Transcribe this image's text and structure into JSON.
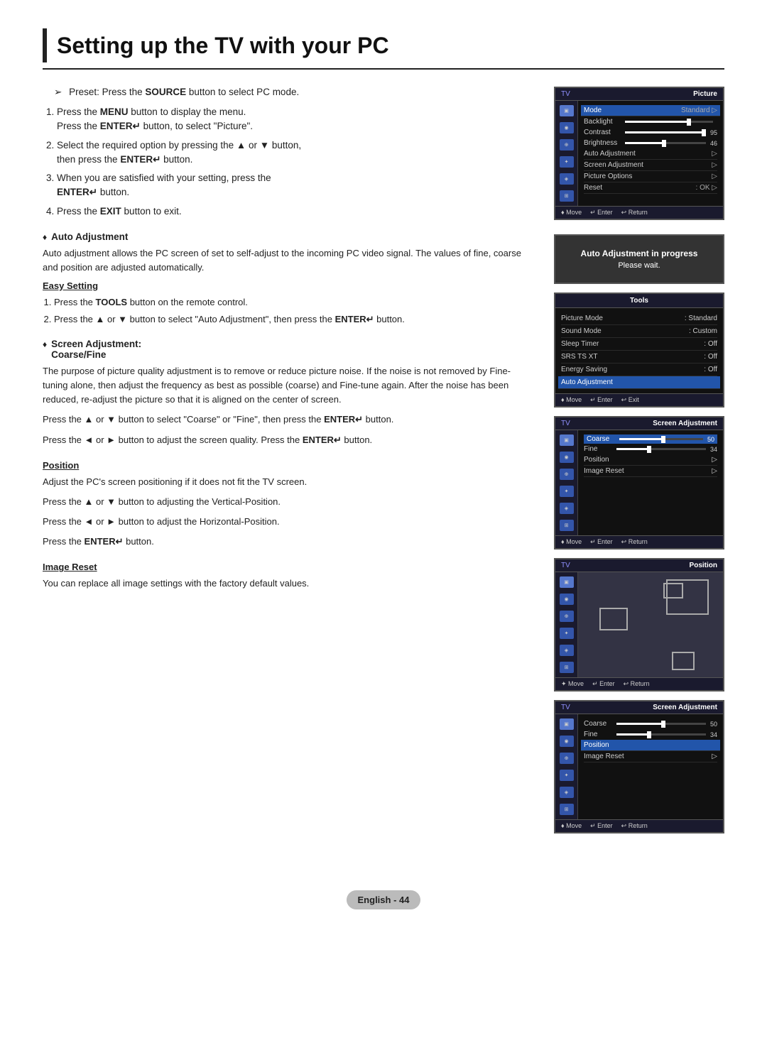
{
  "page": {
    "title": "Setting up the TV with your PC"
  },
  "preset": {
    "text": "Preset: Press the ",
    "bold1": "SOURCE",
    "text2": " button to select PC mode."
  },
  "steps": [
    {
      "num": 1,
      "text": "Press the ",
      "bold": "MENU",
      "text2": " button to display the menu.\nPress the ",
      "bold2": "ENTER",
      "text3": " button, to select \"Picture\"."
    },
    {
      "num": 2,
      "text": "Select the required option by pressing the ▲ or ▼ button,\nthen press the ",
      "bold": "ENTER",
      "text2": " button."
    },
    {
      "num": 3,
      "text": "When you are satisfied with your setting, press the ",
      "bold": "ENTER",
      "text2": " button."
    },
    {
      "num": 4,
      "text": "Press the ",
      "bold": "EXIT",
      "text2": " button to exit."
    }
  ],
  "sections": {
    "auto_adjustment": {
      "title": "Auto Adjustment",
      "body": "Auto adjustment allows the PC screen of set to self-adjust to the incoming PC video signal. The values of fine, coarse and position are adjusted automatically.",
      "easy_setting": {
        "title": "Easy Setting",
        "steps": [
          "Press the TOOLS button on the remote control.",
          "Press the ▲ or ▼ button to select \"Auto Adjustment\", then press the ENTER button."
        ]
      }
    },
    "screen_adjustment": {
      "title": "Screen Adjustment:",
      "subtitle": "Coarse/Fine",
      "body": "The purpose of picture quality adjustment is to remove or reduce picture noise. If the noise is not removed by Fine-tuning alone, then adjust the frequency as best as possible (coarse) and Fine-tune again. After the noise has been reduced, re-adjust the picture so that it is aligned on the center of screen.",
      "instructions": [
        "Press the ▲ or ▼ button to select \"Coarse\" or \"Fine\", then press the ENTER button.",
        "Press the ◄ or ► button to adjust the screen quality. Press the ENTER button."
      ]
    },
    "position": {
      "title": "Position",
      "body": "Adjust the PC's screen positioning if it does not fit the TV screen.",
      "instructions": [
        "Press the ▲ or ▼ button to adjusting the Vertical-Position.",
        "Press the ◄ or ► button to adjust the Horizontal-Position.",
        "Press the ENTER button."
      ]
    },
    "image_reset": {
      "title": "Image Reset",
      "body": "You can replace all image settings with the factory default values."
    }
  },
  "tv_screens": {
    "picture_menu": {
      "header_left": "TV",
      "header_right": "Picture",
      "menu_items": [
        {
          "label": "Mode",
          "value": "Standard",
          "has_arrow": true
        },
        {
          "label": "Backlight",
          "has_slider": true,
          "slider_val": 70
        },
        {
          "label": "Contrast",
          "has_slider": true,
          "slider_val": 95,
          "value": "95"
        },
        {
          "label": "Brightness",
          "has_slider": true,
          "slider_val": 46,
          "value": "46"
        },
        {
          "label": "Auto Adjustment",
          "has_arrow": true
        },
        {
          "label": "Screen Adjustment",
          "has_arrow": true
        },
        {
          "label": "Picture Options",
          "has_arrow": true
        },
        {
          "label": "Reset",
          "value": ": OK",
          "has_arrow": true
        }
      ],
      "footer": [
        "♦ Move",
        "↵ Enter",
        "↩ Return"
      ]
    },
    "auto_adjust_popup": {
      "title": "Auto Adjustment in progress",
      "subtitle": "Please wait."
    },
    "tools_menu": {
      "header": "Tools",
      "items": [
        {
          "label": "Picture Mode",
          "value": ": Standard"
        },
        {
          "label": "Sound Mode",
          "value": ": Custom"
        },
        {
          "label": "Sleep Timer",
          "value": ": Off"
        },
        {
          "label": "SRS TS XT",
          "value": ": Off"
        },
        {
          "label": "Energy Saving",
          "value": ": Off"
        },
        {
          "label": "Auto Adjustment",
          "highlighted": true
        }
      ],
      "footer": [
        "♦ Move",
        "↵ Enter",
        "↩ Exit"
      ]
    },
    "screen_adj": {
      "header_left": "TV",
      "header_right": "Screen Adjustment",
      "menu_items": [
        {
          "label": "Coarse",
          "has_slider": true,
          "slider_val": 50,
          "value": "50"
        },
        {
          "label": "Fine",
          "has_slider": true,
          "slider_val": 34,
          "value": "34"
        },
        {
          "label": "Position",
          "has_arrow": true
        },
        {
          "label": "Image Reset",
          "has_arrow": true
        }
      ],
      "footer": [
        "♦ Move",
        "↵ Enter",
        "↩ Return"
      ]
    },
    "position": {
      "header_left": "TV",
      "header_right": "Position",
      "footer": [
        "✦ Move",
        "↵ Enter",
        "↩ Return"
      ]
    },
    "screen_adj2": {
      "header_left": "TV",
      "header_right": "Screen Adjustment",
      "menu_items": [
        {
          "label": "Coarse",
          "has_slider": true,
          "slider_val": 50,
          "value": "50"
        },
        {
          "label": "Fine",
          "has_slider": true,
          "slider_val": 34,
          "value": "34"
        },
        {
          "label": "Position",
          "has_arrow": true
        },
        {
          "label": "Image Reset",
          "has_arrow": true
        }
      ],
      "footer": [
        "♦ Move",
        "↵ Enter",
        "↩ Return"
      ]
    }
  },
  "footer": {
    "label": "English - 44"
  }
}
